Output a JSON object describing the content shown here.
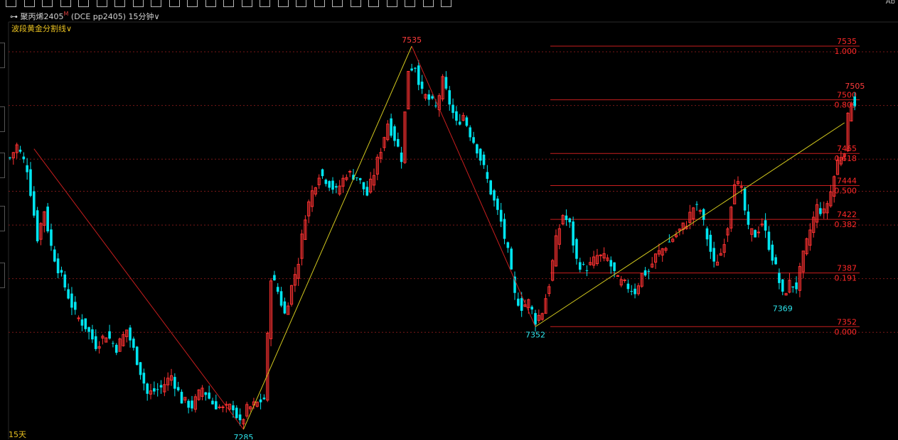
{
  "toolbar": {
    "icons": [
      "zoom-in-icon",
      "list-icon",
      "grid-icon",
      "cursor-icon",
      "alert-icon",
      "chart-icon",
      "square-icon",
      "circle-icon",
      "layers-icon",
      "layout-icon",
      "vertical-line-icon",
      "bracket-icon",
      "bracket-icon",
      "grid-icon",
      "bar-chart-icon",
      "bar-chart-icon",
      "calendar-icon",
      "diamond-icon",
      "arrow-icon",
      "arrow-icon",
      "arrow-icon",
      "cross-icon",
      "diamond-icon",
      "grid-icon",
      "arrow-icon"
    ],
    "right_text": "Ab"
  },
  "header": {
    "symbol": "聚丙烯2405",
    "superscript": "M",
    "exchange_code": "(DCE pp2405)",
    "period": "15分钟"
  },
  "indicator": {
    "name": "波段黄金分割线"
  },
  "bottom": {
    "period_label": "15天"
  },
  "colors": {
    "up_candle": "#ff3232",
    "down_candle": "#00e5f0",
    "fib_line": "#c81e1e",
    "fib_text": "#ff2828",
    "swing_up": "#d2c81e",
    "swing_down": "#c81e1e",
    "pivot_low_text": "#2ee6ee",
    "pivot_high_text": "#ff3c3c"
  },
  "chart_data": {
    "type": "candlestick",
    "ylim": [
      7280,
      7545
    ],
    "swing_points": [
      {
        "bar": 7,
        "price": 7468,
        "label": ""
      },
      {
        "bar": 68,
        "price": 7285,
        "label": "7285"
      },
      {
        "bar": 117,
        "price": 7535,
        "label": "7535"
      },
      {
        "bar": 153,
        "price": 7352,
        "label": "7352"
      },
      {
        "bar": 243,
        "price": 7485,
        "label": ""
      }
    ],
    "pivot_labels": [
      {
        "bar": 68,
        "price": 7285,
        "text": "7285",
        "kind": "low"
      },
      {
        "bar": 117,
        "price": 7535,
        "text": "7535",
        "kind": "high"
      },
      {
        "bar": 153,
        "price": 7352,
        "text": "7352",
        "kind": "low"
      },
      {
        "bar": 225,
        "price": 7369,
        "text": "7369",
        "kind": "low"
      },
      {
        "bar": 245,
        "price": 7505,
        "text": "7505",
        "kind": "high"
      }
    ],
    "fib_levels": [
      {
        "price": 7535,
        "ratio": "1.000"
      },
      {
        "price": 7500,
        "ratio": "0.809"
      },
      {
        "price": 7465,
        "ratio": "0.618"
      },
      {
        "price": 7444,
        "ratio": "0.500"
      },
      {
        "price": 7422,
        "ratio": "0.382"
      },
      {
        "price": 7387,
        "ratio": "0.191"
      },
      {
        "price": 7352,
        "ratio": "0.000"
      }
    ],
    "guide_prices": [
      7535,
      7500,
      7465,
      7444,
      7422,
      7387,
      7352
    ],
    "close_path": [
      [
        0,
        7462
      ],
      [
        2,
        7470
      ],
      [
        5,
        7455
      ],
      [
        8,
        7410
      ],
      [
        10,
        7428
      ],
      [
        12,
        7404
      ],
      [
        14,
        7390
      ],
      [
        17,
        7372
      ],
      [
        19,
        7360
      ],
      [
        22,
        7352
      ],
      [
        25,
        7340
      ],
      [
        28,
        7347
      ],
      [
        31,
        7338
      ],
      [
        34,
        7350
      ],
      [
        37,
        7330
      ],
      [
        40,
        7308
      ],
      [
        44,
        7312
      ],
      [
        47,
        7320
      ],
      [
        50,
        7304
      ],
      [
        53,
        7300
      ],
      [
        56,
        7312
      ],
      [
        59,
        7302
      ],
      [
        62,
        7298
      ],
      [
        65,
        7300
      ],
      [
        67,
        7288
      ],
      [
        69,
        7298
      ],
      [
        72,
        7302
      ],
      [
        74,
        7305
      ],
      [
        76,
        7385
      ],
      [
        78,
        7375
      ],
      [
        80,
        7360
      ],
      [
        82,
        7378
      ],
      [
        84,
        7395
      ],
      [
        86,
        7425
      ],
      [
        88,
        7440
      ],
      [
        90,
        7452
      ],
      [
        92,
        7448
      ],
      [
        95,
        7440
      ],
      [
        98,
        7452
      ],
      [
        101,
        7450
      ],
      [
        104,
        7438
      ],
      [
        106,
        7452
      ],
      [
        108,
        7468
      ],
      [
        110,
        7485
      ],
      [
        112,
        7475
      ],
      [
        114,
        7462
      ],
      [
        116,
        7520
      ],
      [
        118,
        7522
      ],
      [
        120,
        7504
      ],
      [
        122,
        7500
      ],
      [
        124,
        7495
      ],
      [
        126,
        7512
      ],
      [
        128,
        7498
      ],
      [
        130,
        7484
      ],
      [
        132,
        7490
      ],
      [
        134,
        7478
      ],
      [
        136,
        7468
      ],
      [
        138,
        7455
      ],
      [
        140,
        7440
      ],
      [
        143,
        7420
      ],
      [
        145,
        7400
      ],
      [
        147,
        7372
      ],
      [
        149,
        7365
      ],
      [
        151,
        7368
      ],
      [
        153,
        7356
      ],
      [
        155,
        7362
      ],
      [
        157,
        7380
      ],
      [
        159,
        7408
      ],
      [
        161,
        7425
      ],
      [
        163,
        7418
      ],
      [
        165,
        7395
      ],
      [
        167,
        7390
      ],
      [
        169,
        7392
      ],
      [
        171,
        7398
      ],
      [
        174,
        7396
      ],
      [
        177,
        7382
      ],
      [
        180,
        7378
      ],
      [
        182,
        7375
      ],
      [
        184,
        7386
      ],
      [
        186,
        7388
      ],
      [
        188,
        7398
      ],
      [
        191,
        7405
      ],
      [
        194,
        7412
      ],
      [
        197,
        7420
      ],
      [
        199,
        7430
      ],
      [
        201,
        7428
      ],
      [
        203,
        7410
      ],
      [
        205,
        7392
      ],
      [
        207,
        7400
      ],
      [
        209,
        7418
      ],
      [
        211,
        7448
      ],
      [
        213,
        7440
      ],
      [
        215,
        7415
      ],
      [
        217,
        7412
      ],
      [
        219,
        7420
      ],
      [
        221,
        7405
      ],
      [
        223,
        7390
      ],
      [
        225,
        7372
      ],
      [
        227,
        7380
      ],
      [
        229,
        7378
      ],
      [
        231,
        7398
      ],
      [
        233,
        7415
      ],
      [
        235,
        7430
      ],
      [
        237,
        7426
      ],
      [
        239,
        7440
      ],
      [
        241,
        7460
      ],
      [
        243,
        7468
      ],
      [
        244,
        7488
      ],
      [
        245,
        7500
      ],
      [
        246,
        7498
      ]
    ]
  }
}
